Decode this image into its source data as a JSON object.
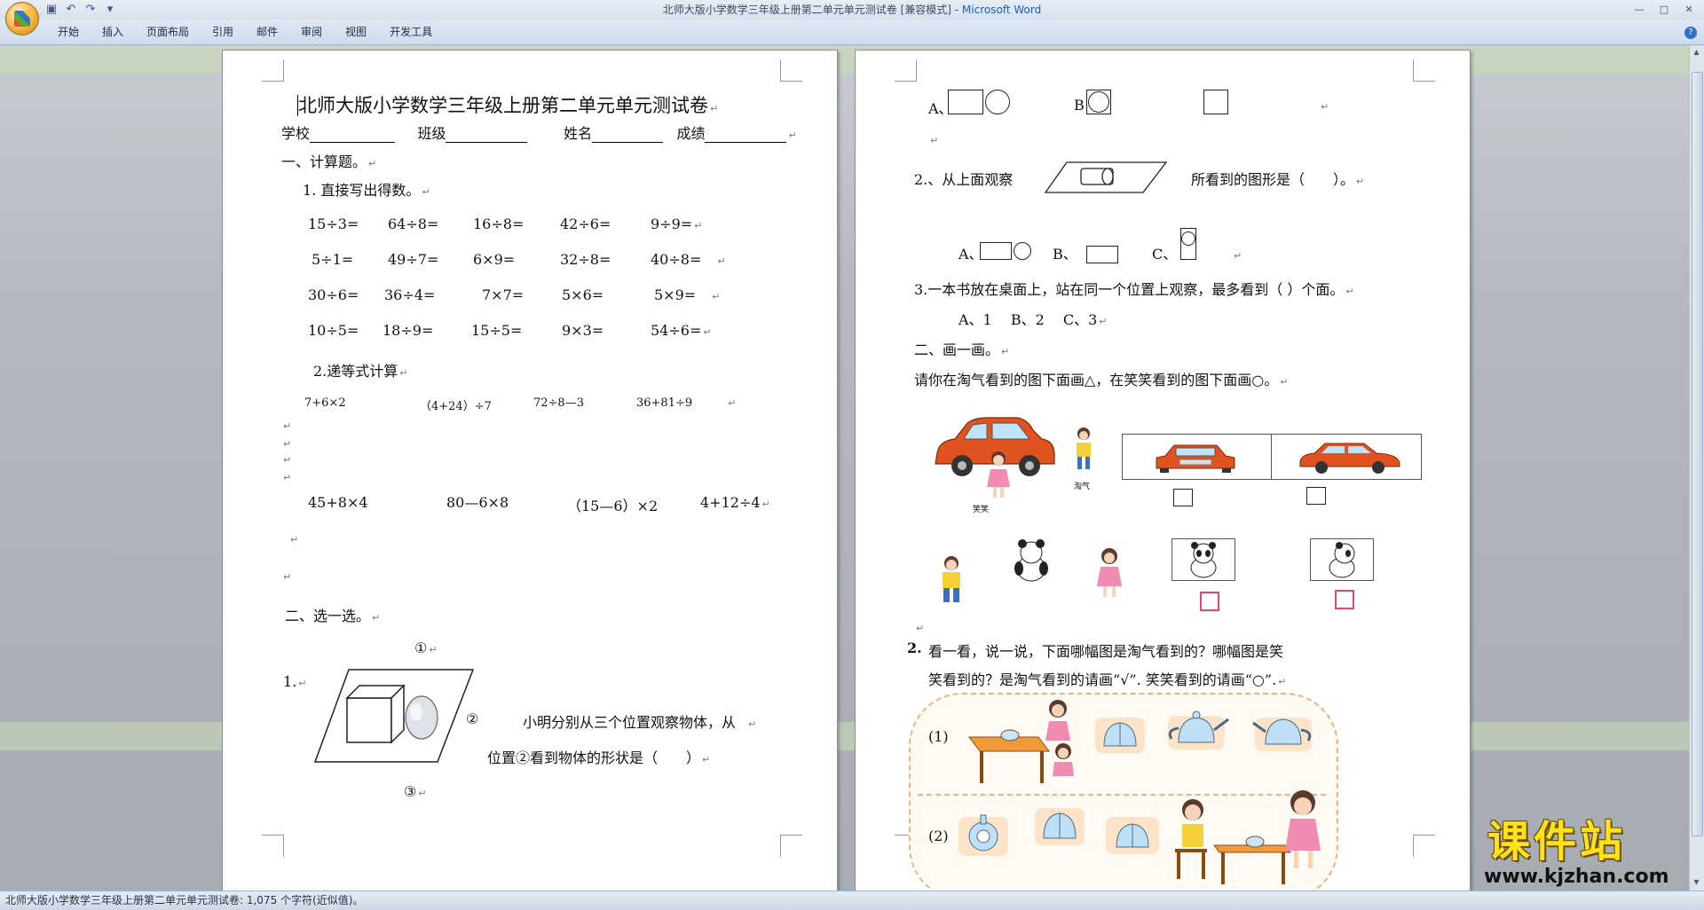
{
  "window": {
    "title": "北师大版小学数学三年级上册第二单元单元测试卷 [兼容模式] - ",
    "app_name": "Microsoft Word"
  },
  "ribbon": {
    "tabs": [
      "开始",
      "插入",
      "页面布局",
      "引用",
      "邮件",
      "审阅",
      "视图",
      "开发工具"
    ]
  },
  "status": {
    "text": "北师大版小学数学三年级上册第二单元单元测试卷: 1,075 个字符(近似值)。"
  },
  "logo": {
    "main": "课件站",
    "url": "www.kjzhan.com"
  },
  "page1": {
    "title": "北师大版小学数学三年级上册第二单元单元测试卷",
    "header_fields": [
      "学校",
      "班级",
      "姓名",
      "成绩"
    ],
    "section1": "一、计算题。",
    "q1": "1. 直接写出得数。",
    "calc_rows": [
      [
        "15÷3=",
        "64÷8=",
        "16÷8=",
        "42÷6=",
        "9÷9="
      ],
      [
        "5÷1=",
        "49÷7=",
        "6×9=",
        "32÷8=",
        "40÷8="
      ],
      [
        "30÷6=",
        "36÷4=",
        "7×7=",
        "5×6=",
        "5×9="
      ],
      [
        "10÷5=",
        "18÷9=",
        "15÷5=",
        "9×3=",
        "54÷6="
      ]
    ],
    "q2": "2.递等式计算",
    "eq_row1": [
      "7+6×2",
      "（4+24）÷7",
      "72÷8—3",
      "36+81÷9"
    ],
    "eq_row2": [
      "45+8×4",
      "80—6×8",
      "（15—6）×2",
      "4+12÷4"
    ],
    "section2": "二、选一选。",
    "mark1": "①",
    "mark2": "②",
    "mark3": "③",
    "q_num": "1.",
    "choice_text1": "小明分别从三个位置观察物体，从",
    "choice_text2": "位置②看到物体的形状是（　　）"
  },
  "page2": {
    "opt_a": "A、",
    "opt_b": "B",
    "q2": "2.、从上面观察",
    "q2_tail": "所看到的图形是（　　）。",
    "q2_opts": [
      "A、",
      "B、",
      "C、"
    ],
    "q3": "3.一本书放在桌面上，站在同一个位置上观察，最多看到（  ）个面。",
    "q3_opts": "A、1　 B、2　 C、3",
    "section": "二、画一画。",
    "instruction": "请你在淘气看到的图下面画△，在笑笑看到的图下面画○。",
    "name_xiaoxiao": "笑笑",
    "name_taoqi": "淘气",
    "q_look_num": "2.",
    "q_look_text1": "看一看，说一说，下面哪幅图是淘气看到的？哪幅图是笑",
    "q_look_text2": "笑看到的？",
    "q_look_bold": "是淘气看到的请画“√”. 笑笑看到的请画“○”.",
    "row1_label": "(1)",
    "row2_label": "(2)"
  },
  "colors": {
    "car": "#e0521f",
    "accent": "#1e5fb4",
    "pink_box": "#e0457b"
  }
}
